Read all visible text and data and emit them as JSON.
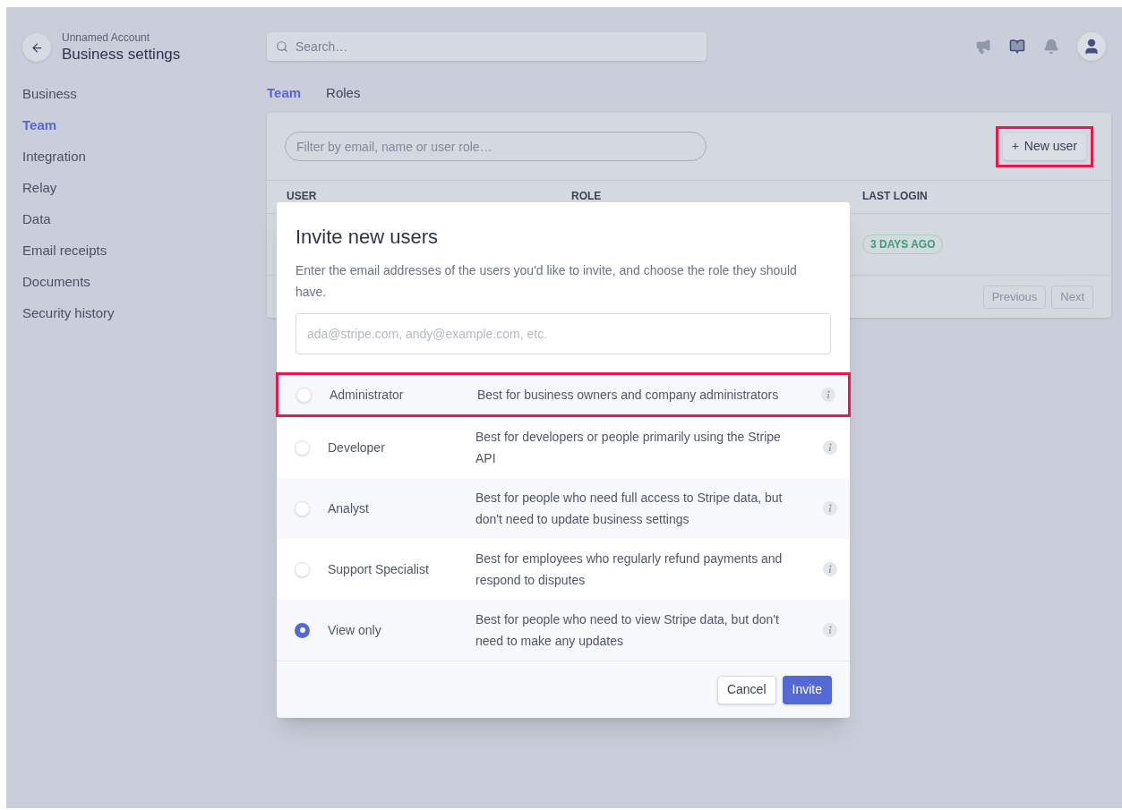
{
  "header": {
    "account": "Unnamed Account",
    "title": "Business settings"
  },
  "search": {
    "placeholder": "Search…"
  },
  "sidebar": {
    "items": [
      {
        "label": "Business",
        "selected": false
      },
      {
        "label": "Team",
        "selected": true
      },
      {
        "label": "Integration",
        "selected": false
      },
      {
        "label": "Relay",
        "selected": false
      },
      {
        "label": "Data",
        "selected": false
      },
      {
        "label": "Email receipts",
        "selected": false
      },
      {
        "label": "Documents",
        "selected": false
      },
      {
        "label": "Security history",
        "selected": false
      }
    ]
  },
  "tabs": [
    {
      "label": "Team",
      "selected": true
    },
    {
      "label": "Roles",
      "selected": false
    }
  ],
  "team": {
    "filter": {
      "placeholder": "Filter by email, name or user role…"
    },
    "new_user_button": {
      "icon": "+",
      "label": "New user",
      "highlighted": true
    },
    "columns": [
      "USER",
      "ROLE",
      "LAST LOGIN"
    ],
    "rows": [
      {
        "last_login": "3 DAYS AGO"
      }
    ],
    "pagination": [
      "Previous",
      "Next"
    ]
  },
  "dialog": {
    "title": "Invite new users",
    "description": "Enter the email addresses of the users you'd like to invite, and choose the role they should have.",
    "email": {
      "placeholder": "ada@stripe.com, andy@example.com, etc."
    },
    "roles": [
      {
        "name": "Administrator",
        "description": "Best for business owners and company administrators",
        "selected": false,
        "highlighted": true
      },
      {
        "name": "Developer",
        "description": "Best for developers or people primarily using the Stripe API",
        "selected": false,
        "highlighted": false
      },
      {
        "name": "Analyst",
        "description": "Best for people who need full access to Stripe data, but don't need to update business settings",
        "selected": false,
        "highlighted": false
      },
      {
        "name": "Support Specialist",
        "description": "Best for employees who regularly refund payments and respond to disputes",
        "selected": false,
        "highlighted": false
      },
      {
        "name": "View only",
        "description": "Best for people who need to view Stripe data, but don't need to make any updates",
        "selected": true,
        "highlighted": false
      }
    ],
    "buttons": {
      "cancel": "Cancel",
      "invite": "Invite"
    }
  }
}
